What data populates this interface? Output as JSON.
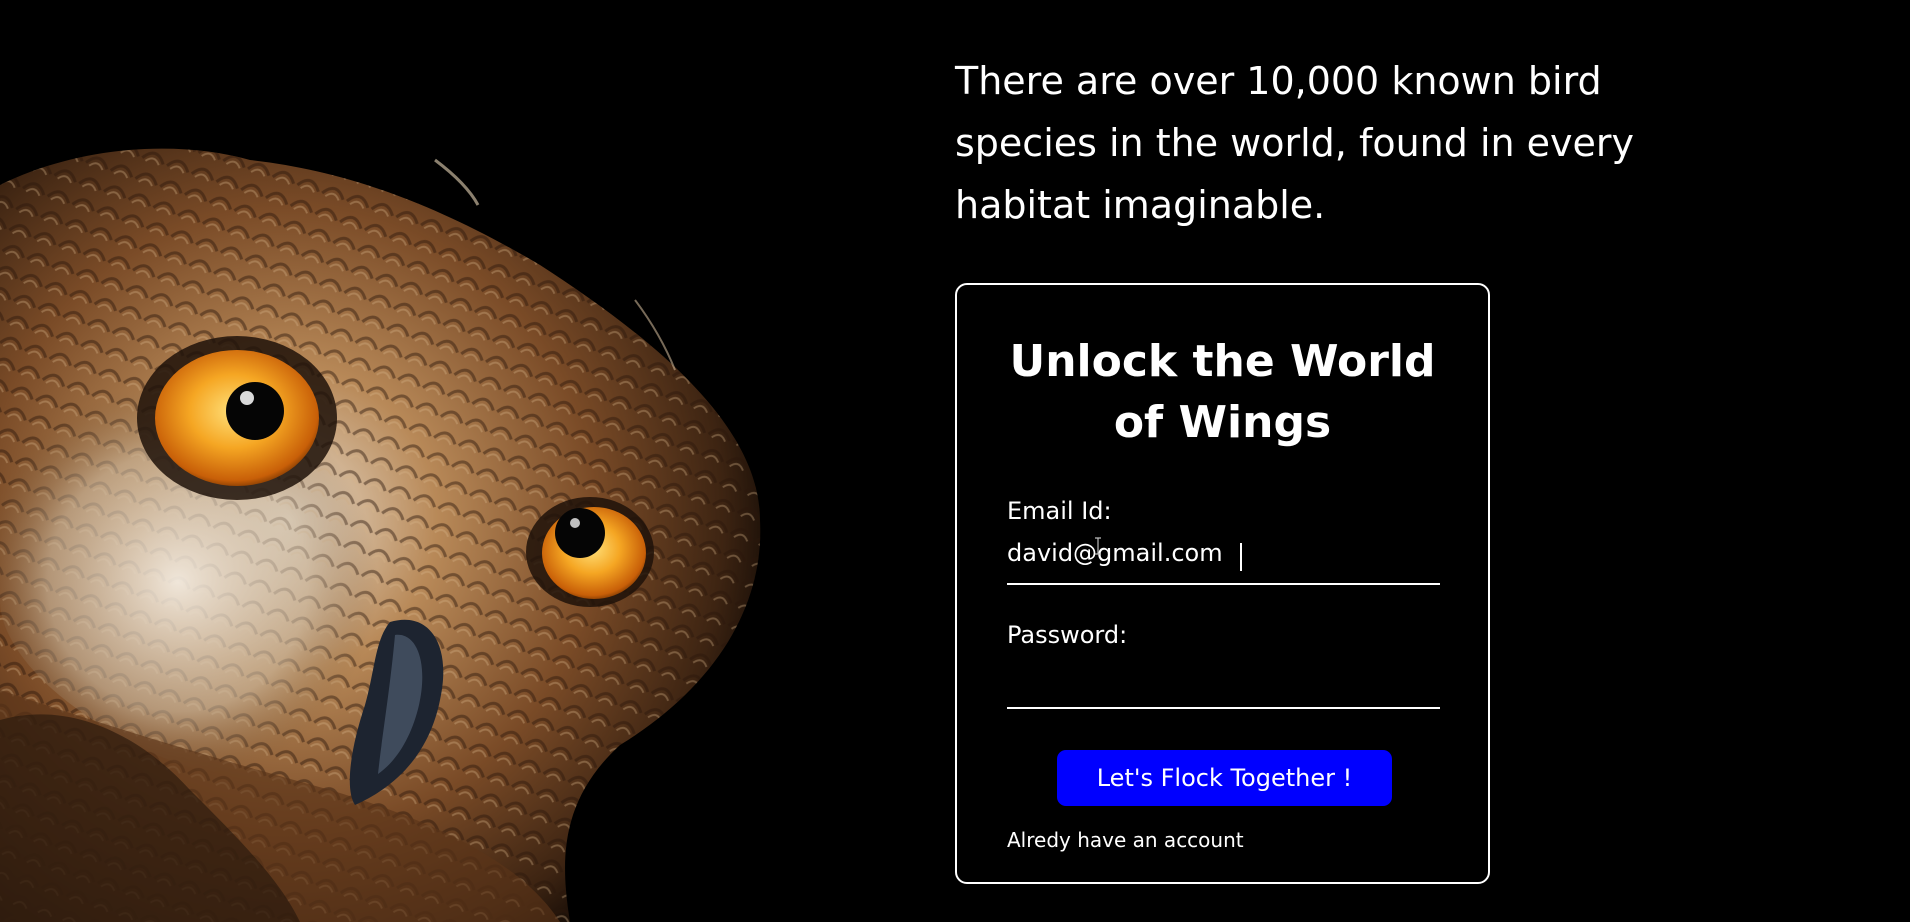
{
  "hero": {
    "tagline": "There are over 10,000 known bird species in the world, found in every habitat imaginable.",
    "image": "owl-portrait"
  },
  "signup_card": {
    "title": "Unlock the World of Wings",
    "email_label": "Email Id:",
    "email_value": "david@gmail.com",
    "password_label": "Password:",
    "password_value": "",
    "submit_label": "Let's Flock Together !",
    "account_link": "Alredy have an account"
  },
  "colors": {
    "background": "#000000",
    "text": "#ffffff",
    "button": "#0000ff",
    "border": "#ffffff"
  }
}
